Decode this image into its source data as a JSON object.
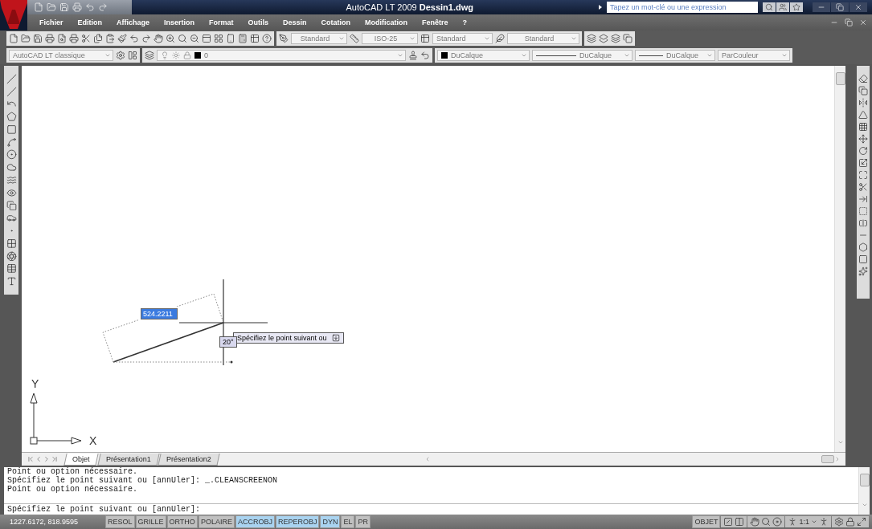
{
  "title_bar": {
    "title": "AutoCAD LT 2009 **Dessin1.dwg**",
    "search": {
      "placeholder": "Tapez un mot-clé ou une expression"
    }
  },
  "menu": [
    "Fichier",
    "Edition",
    "Affichage",
    "Insertion",
    "Format",
    "Outils",
    "Dessin",
    "Cotation",
    "Modification",
    "Fenêtre",
    "?"
  ],
  "styles_toolbar": {
    "text_style": "Standard",
    "dim_style": "ISO-25",
    "table_style": "Standard",
    "mleader_style": "Standard"
  },
  "properties_toolbar": {
    "workspace": "AutoCAD LT classique",
    "layer": "0",
    "color_setting": "DuCalque",
    "linetype": "DuCalque",
    "lineweight": "DuCalque",
    "plot_style": "ParCouleur"
  },
  "canvas": {
    "dynamic_input": {
      "length": "524.2211",
      "angle": "20°",
      "prompt": "Spécifiez le point suivant ou"
    },
    "ucs": {
      "y_label": "Y",
      "x_label": "X"
    }
  },
  "layout_tabs": [
    {
      "label": "Objet",
      "selected": true
    },
    {
      "label": "Présentation1",
      "selected": false
    },
    {
      "label": "Présentation2",
      "selected": false
    }
  ],
  "command_history": [
    "Point ou option nécessaire.",
    "Spécifiez le point suivant ou [annUler]: _.CLEANSCREENON",
    "Point ou option nécessaire."
  ],
  "command_prompt": "Spécifiez le point suivant ou [annUler]:",
  "status_bar": {
    "coordinates": "1227.6172, 818.9595",
    "toggles": [
      {
        "label": "RESOL",
        "on": false
      },
      {
        "label": "GRILLE",
        "on": false
      },
      {
        "label": "ORTHO",
        "on": false
      },
      {
        "label": "POLAIRE",
        "on": false
      },
      {
        "label": "ACCROBJ",
        "on": true
      },
      {
        "label": "REPEROBJ",
        "on": true
      },
      {
        "label": "DYN",
        "on": true
      },
      {
        "label": "EL",
        "on": false
      },
      {
        "label": "PR",
        "on": false
      }
    ],
    "space": "OBJET",
    "scale": "1:1"
  }
}
